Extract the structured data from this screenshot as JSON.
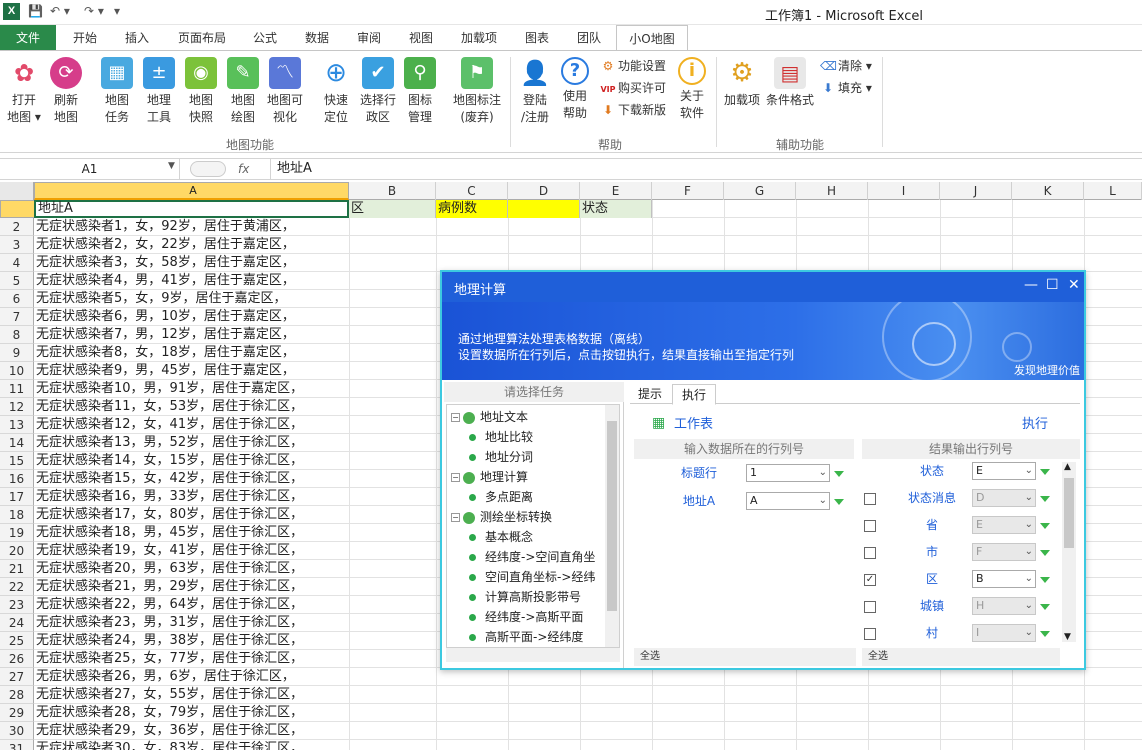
{
  "app": {
    "doc_title": "工作簿1  -  Microsoft Excel"
  },
  "tabs": {
    "file": "文件",
    "items": [
      "开始",
      "插入",
      "页面布局",
      "公式",
      "数据",
      "审阅",
      "视图",
      "加载项",
      "图表",
      "团队",
      "小O地图"
    ]
  },
  "ribbon": {
    "map_group": {
      "label": "地图功能",
      "buttons": [
        {
          "label1": "打开",
          "label2": "地图 ▾",
          "color": "#e24a6a",
          "icon": "flower-icon"
        },
        {
          "label1": "刷新",
          "label2": "地图",
          "color": "#d63d8a",
          "icon": "refresh-icon"
        },
        {
          "label1": "地图",
          "label2": "任务",
          "color": "#49a9e0",
          "icon": "calendar-icon"
        },
        {
          "label1": "地理",
          "label2": "工具",
          "color": "#3a9ae0",
          "icon": "calculator-icon"
        },
        {
          "label1": "地图",
          "label2": "快照",
          "color": "#7cc23a",
          "icon": "camera-icon"
        },
        {
          "label1": "地图",
          "label2": "绘图",
          "color": "#59c05a",
          "icon": "pencil-icon"
        },
        {
          "label1": "地图可",
          "label2": "视化",
          "color": "#5a78d8",
          "icon": "chart-icon"
        },
        {
          "label1": "快速",
          "label2": "定位",
          "color": "#2c8ae0",
          "icon": "crosshair-icon"
        },
        {
          "label1": "选择行",
          "label2": "政区",
          "color": "#3aa0e0",
          "icon": "region-icon"
        },
        {
          "label1": "图标",
          "label2": "管理",
          "color": "#4cb04c",
          "icon": "pin-icon"
        },
        {
          "label1": "地图标注",
          "label2": "(废弃)",
          "color": "#5cc06a",
          "icon": "flag-icon"
        }
      ]
    },
    "help_group": {
      "label": "帮助",
      "buttons": [
        {
          "label1": "登陆",
          "label2": "/注册",
          "color": "#f06a20",
          "icon": "user-icon"
        },
        {
          "label1": "使用",
          "label2": "帮助",
          "color": "#2a7be0",
          "icon": "help-icon"
        }
      ],
      "small": [
        "功能设置",
        "购买许可",
        "下载新版"
      ],
      "about": {
        "label1": "关于",
        "label2": "软件",
        "color": "#f0b020",
        "icon": "info-icon"
      }
    },
    "aux_group": {
      "label": "辅助功能",
      "addins": "加载项",
      "condfmt": "条件格式",
      "clear": "清除 ▾",
      "fill": "填充 ▾"
    }
  },
  "formula_bar": {
    "name_box": "A1",
    "fx": "fx",
    "value": "地址A"
  },
  "grid": {
    "columns": [
      "A",
      "B",
      "C",
      "D",
      "E",
      "F",
      "G",
      "H",
      "I",
      "J",
      "K",
      "L"
    ],
    "headers": {
      "A": "地址A",
      "B": "区",
      "C": "病例数",
      "D": "",
      "E": "状态"
    },
    "rows": [
      "无症状感染者1，女，92岁，居住于黄浦区，",
      "无症状感染者2，女，22岁，居住于嘉定区，",
      "无症状感染者3，女，58岁，居住于嘉定区，",
      "无症状感染者4，男，41岁，居住于嘉定区，",
      "无症状感染者5，女，9岁，居住于嘉定区，",
      "无症状感染者6，男，10岁，居住于嘉定区，",
      "无症状感染者7，男，12岁，居住于嘉定区，",
      "无症状感染者8，女，18岁，居住于嘉定区，",
      "无症状感染者9，男，45岁，居住于嘉定区，",
      "无症状感染者10，男，91岁，居住于嘉定区，",
      "无症状感染者11，女，53岁，居住于徐汇区，",
      "无症状感染者12，女，41岁，居住于徐汇区，",
      "无症状感染者13，男，52岁，居住于徐汇区，",
      "无症状感染者14，女，15岁，居住于徐汇区，",
      "无症状感染者15，女，42岁，居住于徐汇区，",
      "无症状感染者16，男，33岁，居住于徐汇区，",
      "无症状感染者17，女，80岁，居住于徐汇区，",
      "无症状感染者18，男，45岁，居住于徐汇区，",
      "无症状感染者19，女，41岁，居住于徐汇区，",
      "无症状感染者20，男，63岁，居住于徐汇区，",
      "无症状感染者21，男，29岁，居住于徐汇区，",
      "无症状感染者22，男，64岁，居住于徐汇区，",
      "无症状感染者23，男，31岁，居住于徐汇区，",
      "无症状感染者24，男，38岁，居住于徐汇区，",
      "无症状感染者25，女，77岁，居住于徐汇区，",
      "无症状感染者26，男，6岁，居住于徐汇区，",
      "无症状感染者27，女，55岁，居住于徐汇区，",
      "无症状感染者28，女，79岁，居住于徐汇区，",
      "无症状感染者29，女，36岁，居住于徐汇区，",
      "无症状感染者30，女，83岁，居住于徐汇区，"
    ]
  },
  "dialog": {
    "title": "地理计算",
    "banner_line1": "通过地理算法处理表格数据（离线）",
    "banner_line2": "设置数据所在行列后，点击按钮执行，结果直接输出至指定行列",
    "banner_tag": "发现地理价值",
    "left_title": "请选择任务",
    "tree": [
      {
        "level": 0,
        "label": "地址文本"
      },
      {
        "level": 1,
        "label": "地址比较"
      },
      {
        "level": 1,
        "label": "地址分词"
      },
      {
        "level": 0,
        "label": "地理计算"
      },
      {
        "level": 1,
        "label": "多点距离"
      },
      {
        "level": 0,
        "label": "测绘坐标转换"
      },
      {
        "level": 1,
        "label": "基本概念"
      },
      {
        "level": 1,
        "label": "经纬度->空间直角坐"
      },
      {
        "level": 1,
        "label": "空间直角坐标->经纬"
      },
      {
        "level": 1,
        "label": "计算高斯投影带号"
      },
      {
        "level": 1,
        "label": "经纬度->高斯平面"
      },
      {
        "level": 1,
        "label": "高斯平面->经纬度"
      }
    ],
    "tab_hint": "提示",
    "tab_exec": "执行",
    "sheet_label": "工作表",
    "exec_label": "执行",
    "input_head": "输入数据所在的行列号",
    "output_head": "结果输出行列号",
    "inputs": [
      {
        "label": "标题行",
        "value": "1"
      },
      {
        "label": "地址A",
        "value": "A"
      }
    ],
    "outputs": [
      {
        "label": "状态",
        "value": "E",
        "checked": null,
        "disabled": false
      },
      {
        "label": "状态消息",
        "value": "D",
        "checked": false,
        "disabled": true
      },
      {
        "label": "省",
        "value": "E",
        "checked": false,
        "disabled": true
      },
      {
        "label": "市",
        "value": "F",
        "checked": false,
        "disabled": true
      },
      {
        "label": "区",
        "value": "B",
        "checked": true,
        "disabled": false
      },
      {
        "label": "城镇",
        "value": "H",
        "checked": false,
        "disabled": true
      },
      {
        "label": "村",
        "value": "I",
        "checked": false,
        "disabled": true
      }
    ],
    "select_all_left": "全选",
    "select_all_right": "全选"
  }
}
